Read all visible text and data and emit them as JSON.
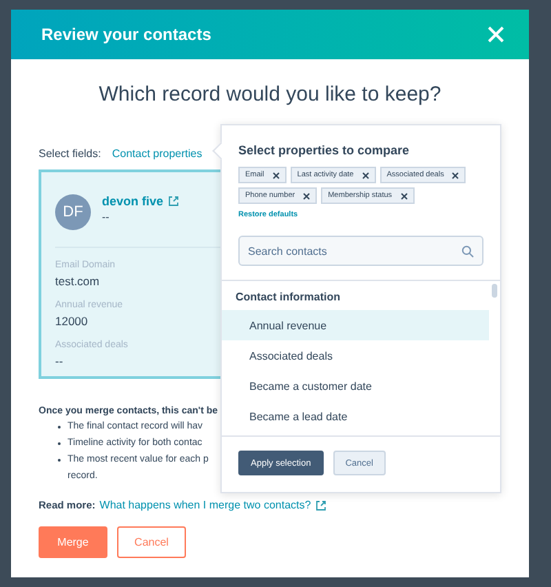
{
  "dialog": {
    "title": "Review your contacts",
    "question": "Which record would you like to keep?"
  },
  "select_fields": {
    "label": "Select fields:",
    "link": "Contact properties"
  },
  "record": {
    "initials": "DF",
    "name": "devon five",
    "subtitle": "--",
    "fields": [
      {
        "label": "Email Domain",
        "value": "test.com"
      },
      {
        "label": "Annual revenue",
        "value": "12000"
      },
      {
        "label": "Associated deals",
        "value": "--"
      }
    ]
  },
  "warning": {
    "intro": "Once you merge contacts, this can't be",
    "bullets": [
      "The final contact record will hav",
      "Timeline activity for both contac",
      "The most recent value for each p"
    ],
    "bullet_tail": "record."
  },
  "read_more": {
    "label": "Read more:",
    "link": "What happens when I merge two contacts?"
  },
  "buttons": [
    {
      "label": "Merge",
      "kind": "primary"
    },
    {
      "label": "Cancel",
      "kind": "secondary"
    }
  ],
  "popover": {
    "title": "Select properties to compare",
    "tags": [
      "Email",
      "Last activity date",
      "Associated deals",
      "Phone number",
      "Membership status"
    ],
    "restore": "Restore defaults",
    "search": {
      "placeholder": "Search contacts"
    },
    "group": "Contact information",
    "items": [
      {
        "label": "Annual revenue",
        "selected": true
      },
      {
        "label": "Associated deals",
        "selected": false
      },
      {
        "label": "Became a customer date",
        "selected": false
      },
      {
        "label": "Became a lead date",
        "selected": false
      }
    ],
    "buttons": [
      {
        "label": "Apply selection",
        "kind": "primary"
      },
      {
        "label": "Cancel",
        "kind": "secondary"
      }
    ]
  }
}
